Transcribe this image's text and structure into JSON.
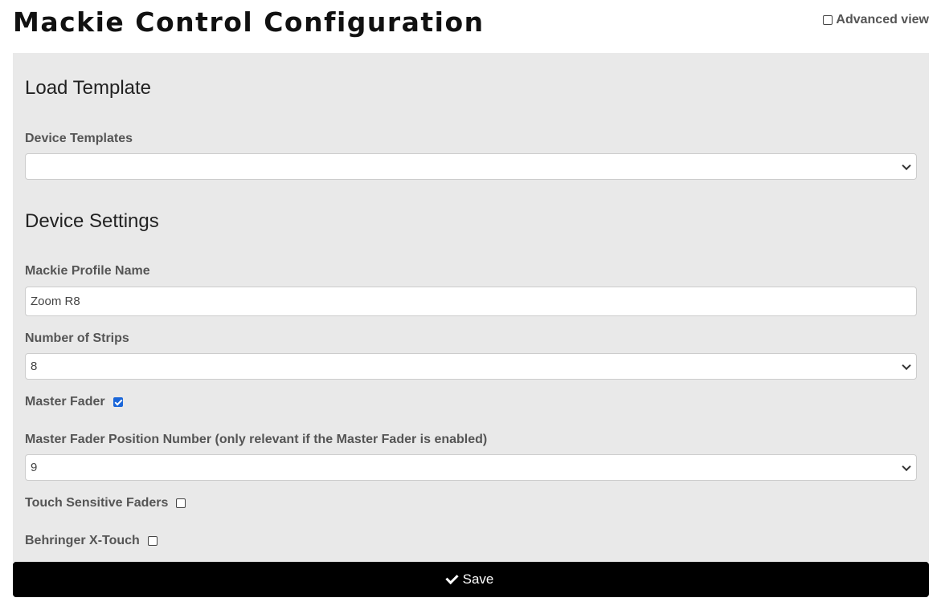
{
  "header": {
    "title": "Mackie Control Configuration",
    "advanced_view": {
      "label": "Advanced view",
      "checked": false
    }
  },
  "load_template": {
    "heading": "Load Template",
    "device_templates": {
      "label": "Device Templates",
      "value": ""
    }
  },
  "device_settings": {
    "heading": "Device Settings",
    "profile_name": {
      "label": "Mackie Profile Name",
      "value": "Zoom R8"
    },
    "number_of_strips": {
      "label": "Number of Strips",
      "value": "8"
    },
    "master_fader": {
      "label": "Master Fader",
      "checked": true
    },
    "master_fader_position": {
      "label": "Master Fader Position Number (only relevant if the Master Fader is enabled)",
      "value": "9"
    },
    "touch_sensitive": {
      "label": "Touch Sensitive Faders",
      "checked": false
    },
    "x_touch": {
      "label": "Behringer X-Touch",
      "checked": false
    }
  },
  "save_button": {
    "label": "Save",
    "icon": "check-icon"
  },
  "colors": {
    "panel": "#e9e9e9",
    "save_bg": "#000000",
    "checkbox_checked": "#1a66d9"
  }
}
